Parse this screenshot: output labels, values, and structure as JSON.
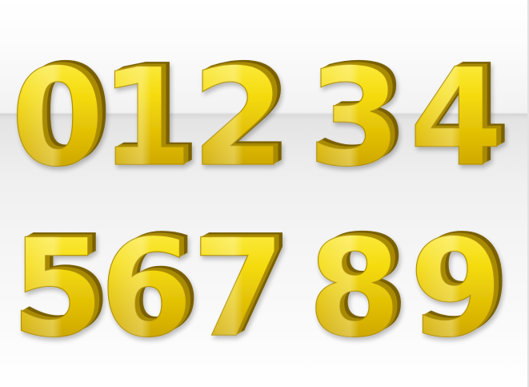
{
  "image": {
    "digits_row1": [
      "0",
      "1",
      "2",
      "3",
      "4"
    ],
    "digits_row2": [
      "5",
      "6",
      "7",
      "8",
      "9"
    ],
    "colors": {
      "gold_light": "#fff35a",
      "gold_mid": "#e9c800",
      "gold_dark": "#8a6e00",
      "background_top": "#ffffff",
      "background_floor": "#e4e4e4"
    }
  }
}
